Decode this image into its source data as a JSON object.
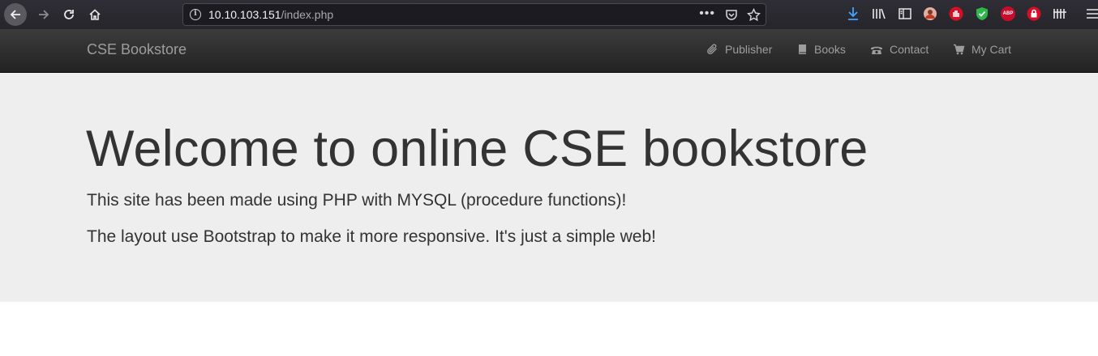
{
  "browser": {
    "url_host": "10.10.103.151",
    "url_path": "/index.php",
    "more_glyph": "•••",
    "icons": [
      "back-icon",
      "forward-icon",
      "reload-icon",
      "home-icon",
      "info-icon",
      "pocket-icon",
      "bookmark-star-icon",
      "download-icon",
      "library-icon",
      "sidebar-icon",
      "profile-icon",
      "block-icon",
      "shield-icon",
      "adblock-plus-icon",
      "lock-extension-icon",
      "tracker-icon",
      "menu-icon"
    ],
    "abp_label": "ABP"
  },
  "navbar": {
    "brand": "CSE Bookstore",
    "items": [
      {
        "label": "Publisher",
        "icon": "paperclip-icon"
      },
      {
        "label": "Books",
        "icon": "book-icon"
      },
      {
        "label": "Contact",
        "icon": "phone-icon"
      },
      {
        "label": "My Cart",
        "icon": "cart-icon"
      }
    ]
  },
  "jumbotron": {
    "title": "Welcome to online CSE bookstore",
    "line1": "This site has been made using PHP with MYSQL (procedure functions)!",
    "line2": "The layout use Bootstrap to make it more responsive. It's just a simple web!"
  },
  "colors": {
    "navbar_bg": "#222222",
    "jumbotron_bg": "#eeeeee",
    "nav_text": "#9d9d9d",
    "text": "#333333"
  }
}
